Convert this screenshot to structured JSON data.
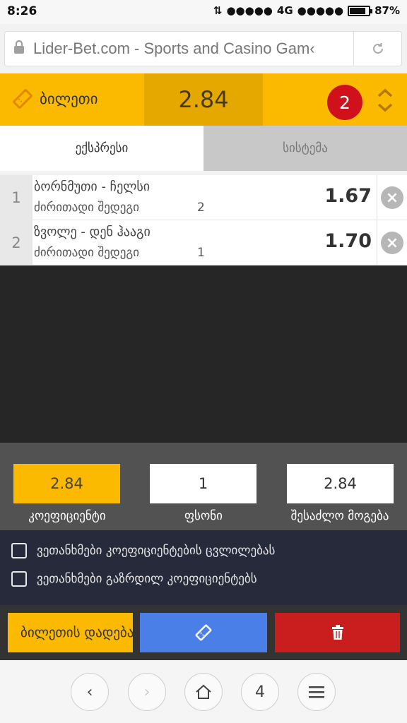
{
  "status_bar": {
    "time": "8:26",
    "network": "4G",
    "battery": "87%",
    "battery_level": 0.87
  },
  "browser": {
    "url": "Lider-Bet.com - Sports and Casino Gam‹"
  },
  "ticket": {
    "title": "ბილეთი",
    "total_odds": "2.84",
    "count": "2"
  },
  "tabs": [
    {
      "label": "ექსპრესი",
      "active": true
    },
    {
      "label": "სისტემა",
      "active": false
    }
  ],
  "bets": [
    {
      "num": "1",
      "teams": "ბორნმუთი - ჩელსი",
      "market": "ძირითადი შედეგი",
      "outcome": "2",
      "odds": "1.67"
    },
    {
      "num": "2",
      "teams": "ზვოლე - დენ ჰააგი",
      "market": "ძირითადი შედეგი",
      "outcome": "1",
      "odds": "1.70"
    }
  ],
  "summary": {
    "odds_value": "2.84",
    "odds_label": "კოეფიციენტი",
    "stake_value": "1",
    "stake_label": "ფსონი",
    "win_value": "2.84",
    "win_label": "შესაძლო მოგება"
  },
  "agreements": [
    {
      "label": "ვეთანხმები კოეფიციენტების ცვლილებას",
      "checked": false
    },
    {
      "label": "ვეთანხმები გაზრდილ კოეფიციენტებს",
      "checked": false
    }
  ],
  "actions": {
    "save_label": "ბილეთის დადება"
  },
  "nav": {
    "tabs_count": "4"
  },
  "colors": {
    "accent": "#fbb900",
    "badge": "#d0101a",
    "blue": "#4a7fe8",
    "red": "#c81e1e"
  }
}
